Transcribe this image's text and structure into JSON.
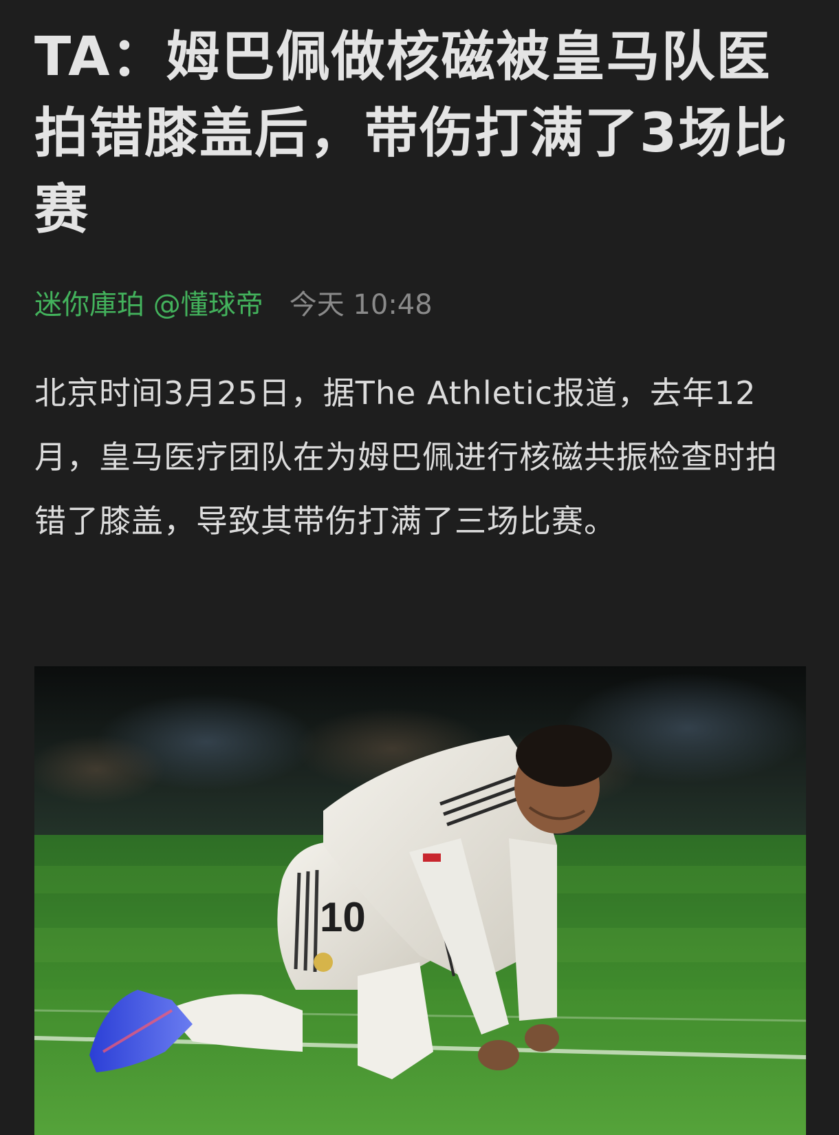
{
  "article": {
    "title": "TA：姆巴佩做核磁被皇马队医拍错膝盖后，带伤打满了3场比赛",
    "author": "迷你庫珀 @懂球帝",
    "time": "今天 10:48",
    "body": "北京时间3月25日，据The Athletic报道，去年12月，皇马医疗团队在为姆巴佩进行核磁共振检查时拍错了膝盖，导致其带伤打满了三场比赛。"
  },
  "photo": {
    "jersey_number": "10",
    "description_icon": "player-kneeling-photo"
  },
  "colors": {
    "background": "#1e1e1e",
    "author": "#43b25c",
    "time": "#8a8a8a",
    "title": "#e4e4e4",
    "body": "#dcdcdc"
  }
}
